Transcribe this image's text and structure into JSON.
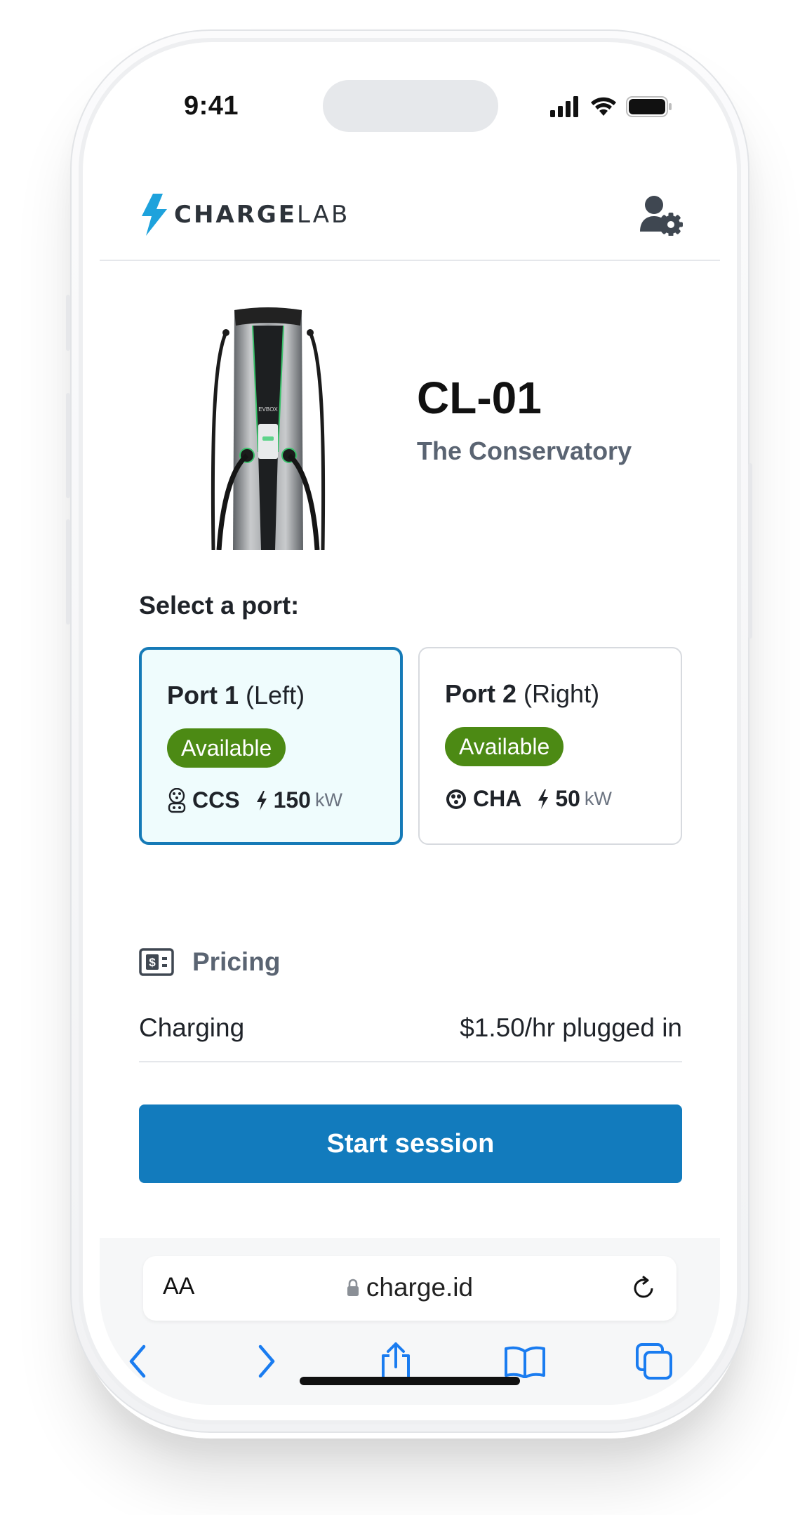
{
  "status_bar": {
    "time": "9:41"
  },
  "header": {
    "logo_bold": "CHARGE",
    "logo_light": "LAB",
    "account_icon": "user-settings-icon"
  },
  "station": {
    "id": "CL-01",
    "name": "The Conservatory"
  },
  "ports": {
    "label": "Select a port:",
    "items": [
      {
        "name": "Port 1",
        "side": "(Left)",
        "status": "Available",
        "connector": "CCS",
        "power": "150",
        "unit": "kW",
        "selected": true
      },
      {
        "name": "Port 2",
        "side": "(Right)",
        "status": "Available",
        "connector": "CHA",
        "power": "50",
        "unit": "kW",
        "selected": false
      }
    ]
  },
  "pricing": {
    "title": "Pricing",
    "row_label": "Charging",
    "row_value": "$1.50/hr plugged in"
  },
  "actions": {
    "start_label": "Start session"
  },
  "browser": {
    "text_size": "AA",
    "url": "charge.id"
  },
  "colors": {
    "brand_blue": "#127bbd",
    "selected_border": "#157ab7",
    "selected_bg": "#effcfd",
    "available_green": "#4c8a14",
    "logo_bolt": "#1ea2dc",
    "ios_blue": "#1a7cf0"
  }
}
